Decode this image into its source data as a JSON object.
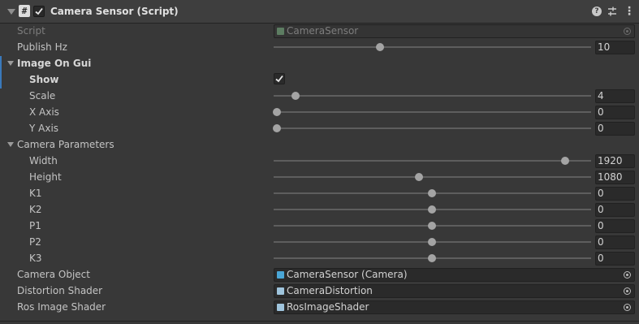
{
  "header": {
    "title": "Camera Sensor (Script)",
    "enabled": true,
    "icons": [
      "fold-arrow-icon",
      "script-icon",
      "help-icon",
      "presets-icon",
      "more-icon"
    ]
  },
  "script": {
    "label": "Script",
    "value": "CameraSensor"
  },
  "publish_hz": {
    "label": "Publish Hz",
    "value": "10",
    "slider_fraction": 0.34
  },
  "image_on_gui": {
    "label": "Image On Gui",
    "show": {
      "label": "Show",
      "checked": true
    },
    "scale": {
      "label": "Scale",
      "value": "4",
      "slider_fraction": 0.07
    },
    "x_axis": {
      "label": "X Axis",
      "value": "0",
      "slider_fraction": 0.0
    },
    "y_axis": {
      "label": "Y Axis",
      "value": "0",
      "slider_fraction": 0.0
    }
  },
  "camera_parameters": {
    "label": "Camera Parameters",
    "width": {
      "label": "Width",
      "value": "1920",
      "slider_fraction": 0.92
    },
    "height": {
      "label": "Height",
      "value": "1080",
      "slider_fraction": 0.46
    },
    "k1": {
      "label": "K1",
      "value": "0",
      "slider_fraction": 0.5
    },
    "k2": {
      "label": "K2",
      "value": "0",
      "slider_fraction": 0.5
    },
    "p1": {
      "label": "P1",
      "value": "0",
      "slider_fraction": 0.5
    },
    "p2": {
      "label": "P2",
      "value": "0",
      "slider_fraction": 0.5
    },
    "k3": {
      "label": "K3",
      "value": "0",
      "slider_fraction": 0.5
    }
  },
  "camera_object": {
    "label": "Camera Object",
    "value": "CameraSensor (Camera)"
  },
  "distortion_shader": {
    "label": "Distortion Shader",
    "value": "CameraDistortion"
  },
  "ros_image_shader": {
    "label": "Ros Image Shader",
    "value": "RosImageShader"
  },
  "colors": {
    "background": "#383838",
    "header": "#3e3e3e",
    "field": "#2a2a2a",
    "accent_selection": "#3a79bb",
    "slider_thumb": "#a4a4a4"
  }
}
